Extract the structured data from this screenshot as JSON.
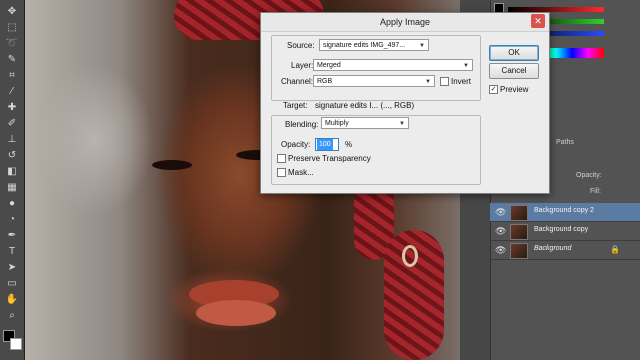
{
  "dialog": {
    "title": "Apply Image",
    "source_label": "Source:",
    "source_value": "signature edits IMG_497...",
    "layer_label": "Layer:",
    "layer_value": "Merged",
    "channel_label": "Channel:",
    "channel_value": "RGB",
    "invert_label": "Invert",
    "invert_checked": false,
    "target_label": "Target:",
    "target_value": "signature edits I... (..., RGB)",
    "blending_label": "Blending:",
    "blending_value": "Multiply",
    "opacity_label": "Opacity:",
    "opacity_value": "100",
    "opacity_unit": "%",
    "preserve_transparency_label": "Preserve Transparency",
    "preserve_transparency_checked": false,
    "mask_label": "Mask...",
    "mask_checked": false,
    "ok_label": "OK",
    "cancel_label": "Cancel",
    "preview_label": "Preview",
    "preview_checked": true
  },
  "panels": {
    "paths_tab": "Paths",
    "opacity_label": "Opacity:",
    "fill_label": "Fill:",
    "layers": [
      {
        "name": "Background copy 2",
        "selected": true,
        "locked": false
      },
      {
        "name": "Background copy",
        "selected": false,
        "locked": false
      },
      {
        "name": "Background",
        "selected": false,
        "locked": true
      }
    ]
  },
  "colors": {
    "accent": "#3399ff",
    "close_button": "#d9534f",
    "selected_layer": "#5b7ba3"
  }
}
